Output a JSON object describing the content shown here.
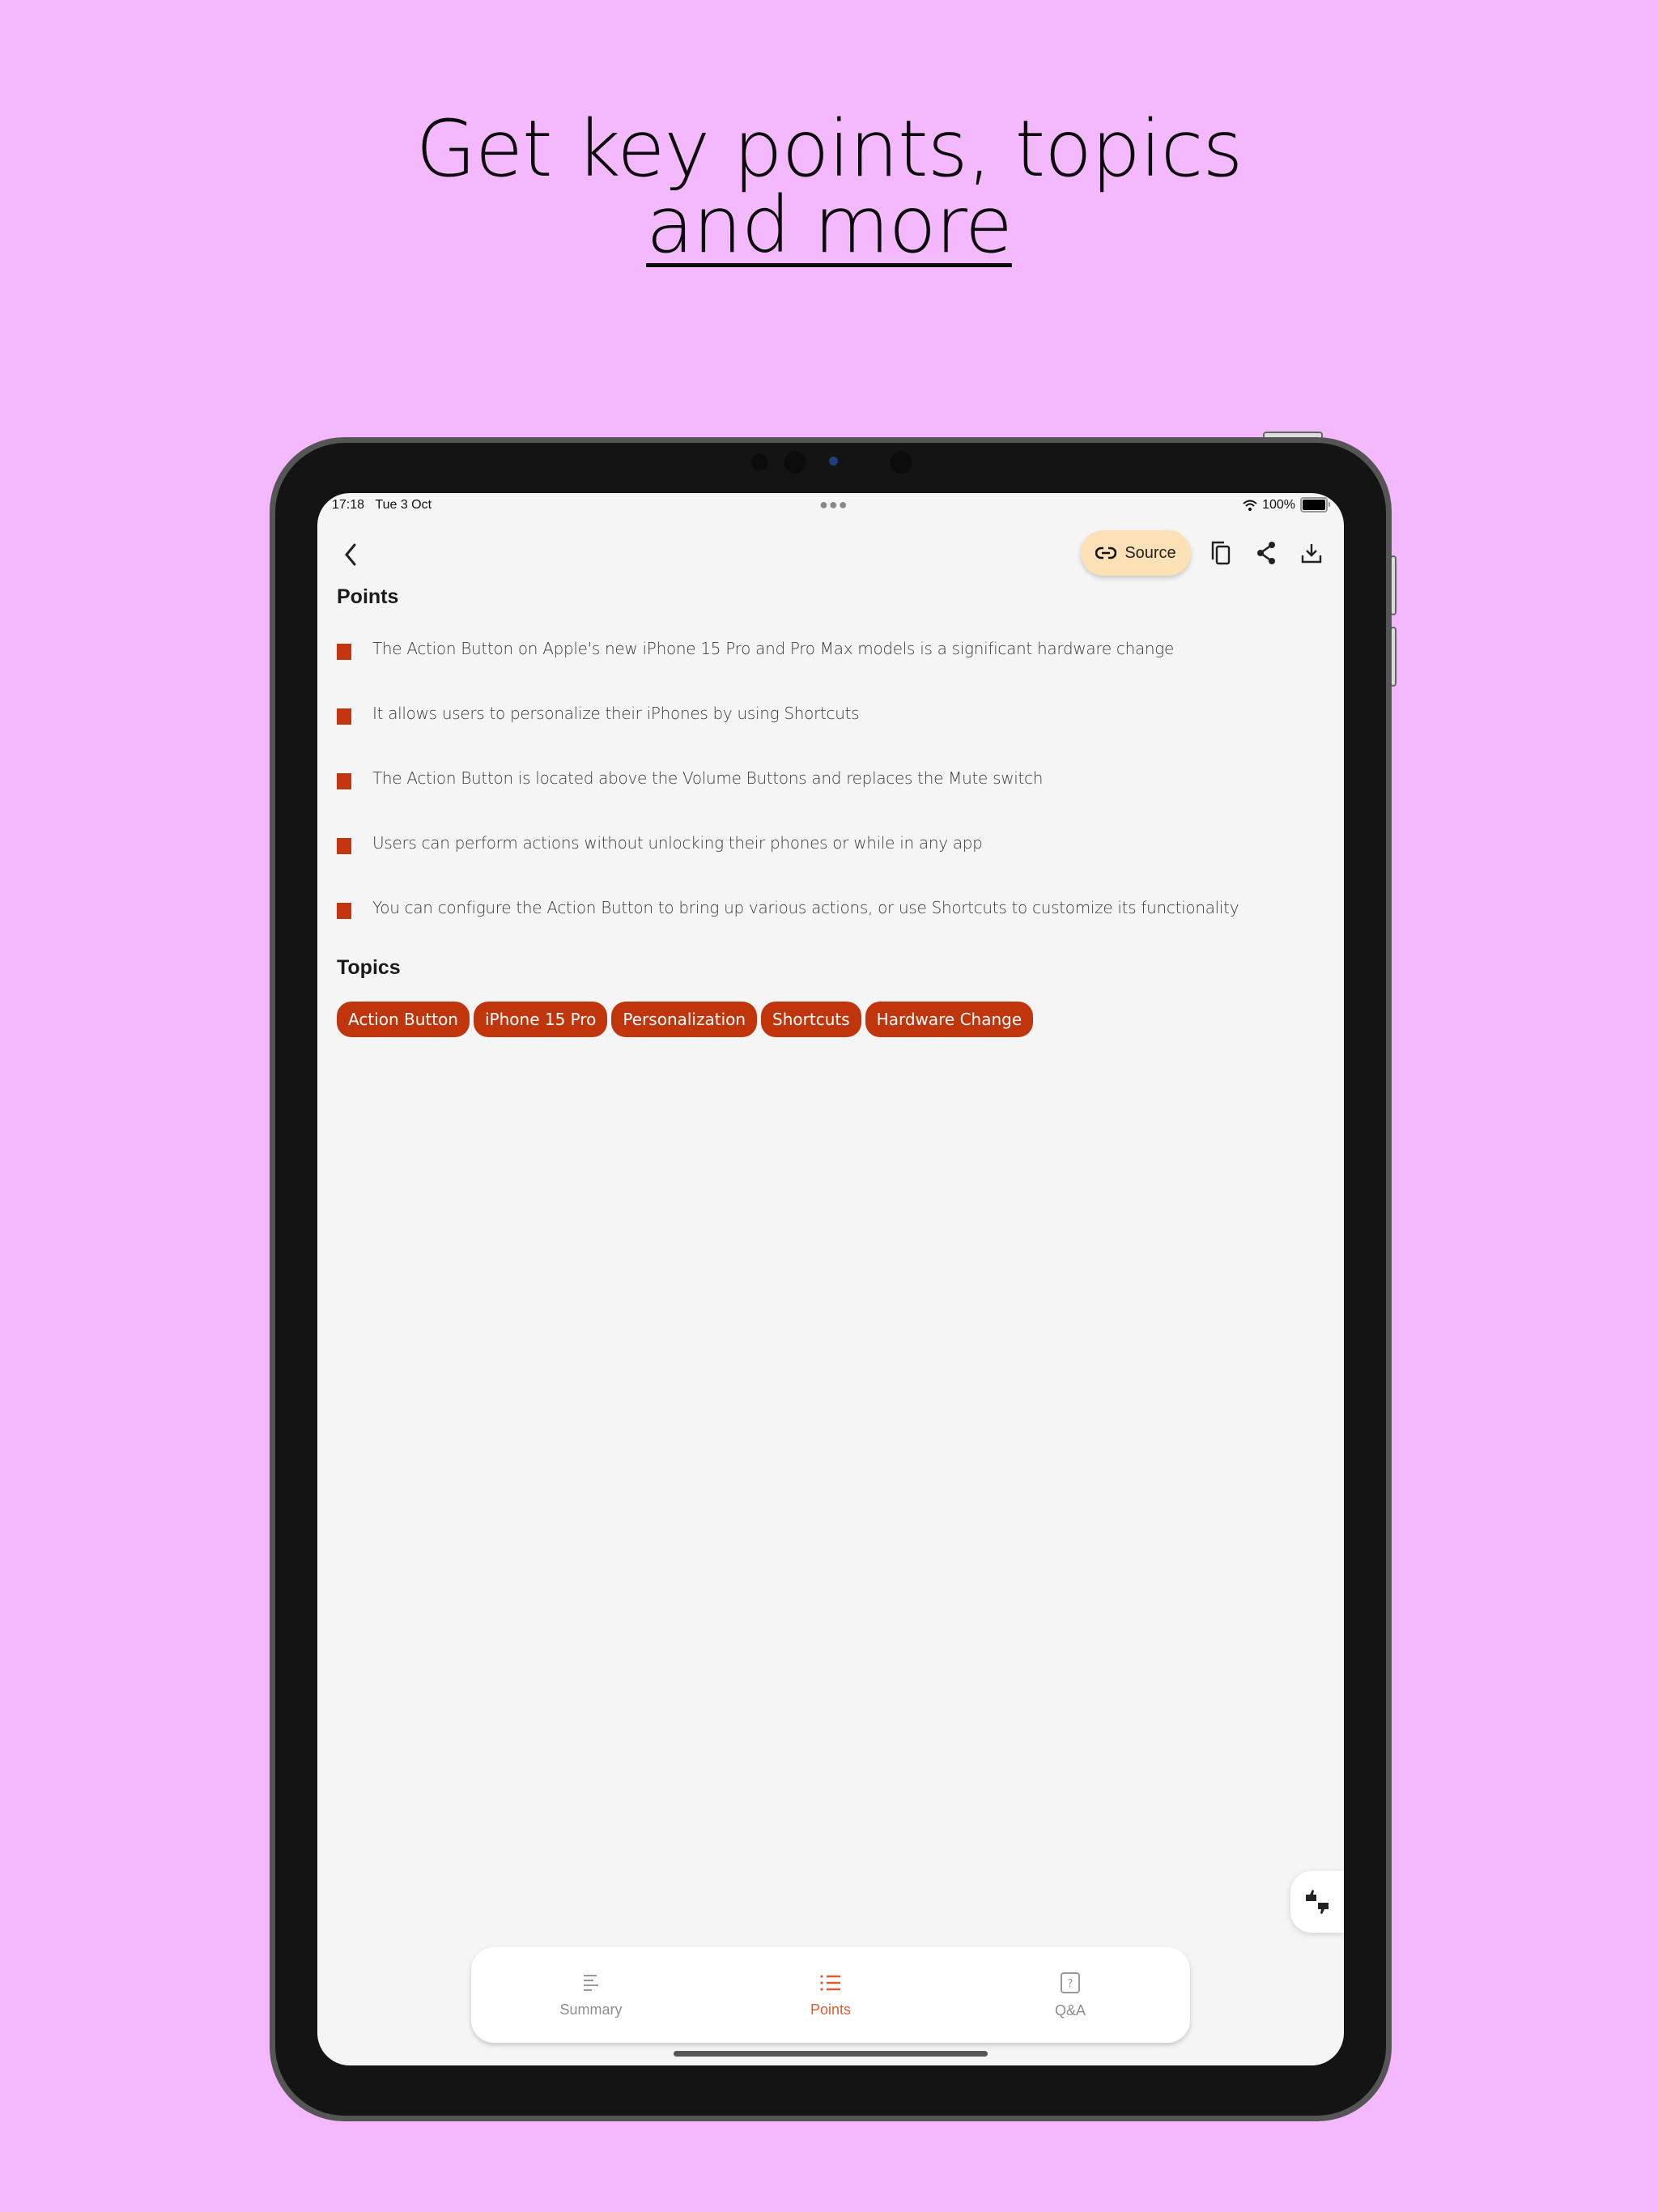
{
  "headline": {
    "line1": "Get key points, topics",
    "line2": "and more"
  },
  "status_bar": {
    "time": "17:18",
    "date": "Tue 3 Oct",
    "battery": "100%",
    "wifi_icon": "wifi-icon",
    "battery_level": 1.0
  },
  "toolbar": {
    "back_icon": "chevron-left-icon",
    "source_label": "Source",
    "source_icon": "link-icon",
    "copy_icon": "copy-icon",
    "share_icon": "share-icon",
    "download_icon": "download-icon"
  },
  "points": {
    "title": "Points",
    "items": [
      "The Action Button on Apple's new iPhone 15 Pro and Pro Max models is a significant hardware change",
      "It allows users to personalize their iPhones by using Shortcuts",
      "The Action Button is located above the Volume Buttons and replaces the Mute switch",
      "Users can perform actions without unlocking their phones or while in any app",
      "You can configure the Action Button to bring up various actions, or use Shortcuts to customize its functionality"
    ]
  },
  "topics": {
    "title": "Topics",
    "items": [
      "Action Button",
      "iPhone 15 Pro",
      "Personalization",
      "Shortcuts",
      "Hardware Change"
    ]
  },
  "bottom_nav": {
    "tabs": [
      {
        "label": "Summary",
        "icon": "summary-lines-icon",
        "active": false
      },
      {
        "label": "Points",
        "icon": "list-icon",
        "active": true
      },
      {
        "label": "Q&A",
        "icon": "question-box-icon",
        "active": false
      }
    ]
  },
  "colors": {
    "background": "#f4b9fc",
    "accent": "#c1350d",
    "active_tab": "#e35b2c",
    "source_button": "#fde0b5"
  }
}
